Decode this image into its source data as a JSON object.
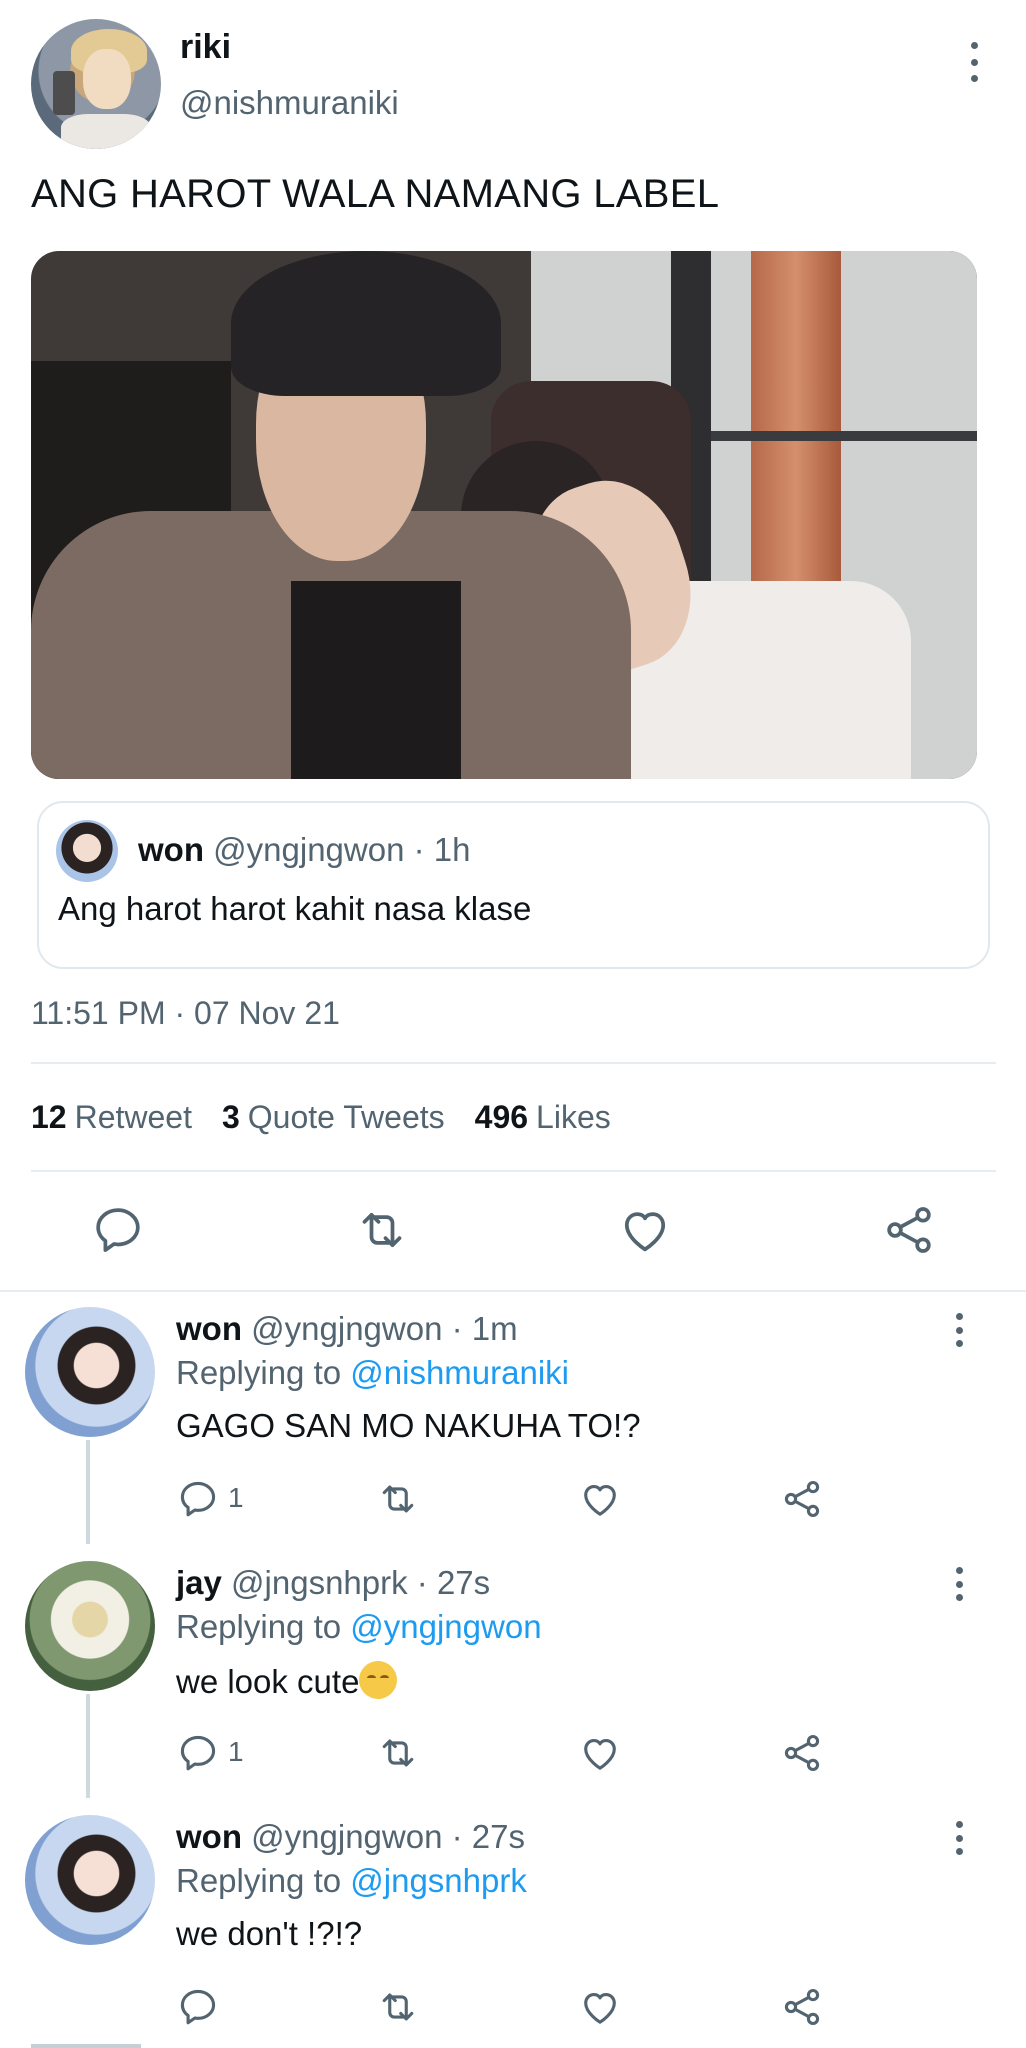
{
  "tweet": {
    "display_name": "riki",
    "handle": "@nishmuraniki",
    "text": "ANG HAROT WALA NAMANG LABEL",
    "quoted": {
      "name": "won",
      "meta": "@yngjngwon · 1h",
      "text": "Ang harot harot kahit nasa klase"
    },
    "timestamp": "11:51 PM · 07 Nov 21",
    "stats": {
      "retweets": "12",
      "retweets_label": "Retweet",
      "quotes": "3",
      "quotes_label": "Quote Tweets",
      "likes": "496",
      "likes_label": "Likes"
    }
  },
  "replies": [
    {
      "name": "won",
      "meta": "@yngjngwon · 1m",
      "replying_prefix": "Replying to ",
      "replying_to": "@nishmuraniki",
      "text": "GAGO SAN MO NAKUHA TO!?",
      "reply_count": "1"
    },
    {
      "name": "jay",
      "meta": "@jngsnhprk · 27s",
      "replying_prefix": "Replying to ",
      "replying_to": "@yngjngwon",
      "text": "we look cute",
      "reply_count": "1"
    },
    {
      "name": "won",
      "meta": "@yngjngwon · 27s",
      "replying_prefix": "Replying to ",
      "replying_to": "@jngsnhprk",
      "text": "we don't !?!?",
      "reply_count": ""
    }
  ],
  "icons": {
    "reply": "reply-icon",
    "retweet": "retweet-icon",
    "like": "heart-icon",
    "share": "share-icon",
    "more": "more-vertical-icon",
    "emoji": "relieved-face-emoji"
  },
  "colors": {
    "text": "#0f1419",
    "secondary": "#536471",
    "link": "#1d9bf0",
    "divider": "#e7ecf0"
  }
}
